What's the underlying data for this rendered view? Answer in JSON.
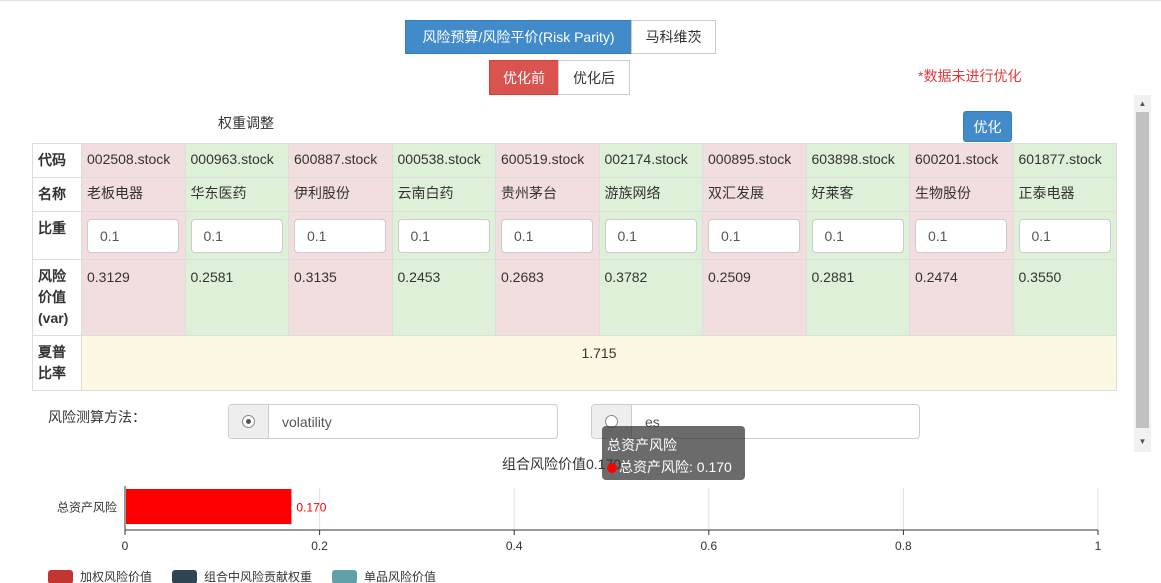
{
  "method_tabs": [
    {
      "label": "风险预算/风险平价(Risk Parity)",
      "active": true
    },
    {
      "label": "马科维茨",
      "active": false
    }
  ],
  "phase_tabs": [
    {
      "label": "优化前",
      "active": true
    },
    {
      "label": "优化后",
      "active": false
    }
  ],
  "warning": "*数据未进行优化",
  "section_title": "权重调整",
  "optimize_label": "优化",
  "table": {
    "row_headers": {
      "code": "代码",
      "name": "名称",
      "weight": "比重",
      "var": "风险价值(var)",
      "sharpe": "夏普比率"
    },
    "stocks": [
      {
        "code": "002508.stock",
        "name": "老板电器",
        "weight": "0.1",
        "var": "0.3129",
        "tone": "pink"
      },
      {
        "code": "000963.stock",
        "name": "华东医药",
        "weight": "0.1",
        "var": "0.2581",
        "tone": "green"
      },
      {
        "code": "600887.stock",
        "name": "伊利股份",
        "weight": "0.1",
        "var": "0.3135",
        "tone": "pink"
      },
      {
        "code": "000538.stock",
        "name": "云南白药",
        "weight": "0.1",
        "var": "0.2453",
        "tone": "green"
      },
      {
        "code": "600519.stock",
        "name": "贵州茅台",
        "weight": "0.1",
        "var": "0.2683",
        "tone": "pink"
      },
      {
        "code": "002174.stock",
        "name": "游族网络",
        "weight": "0.1",
        "var": "0.3782",
        "tone": "green"
      },
      {
        "code": "000895.stock",
        "name": "双汇发展",
        "weight": "0.1",
        "var": "0.2509",
        "tone": "pink"
      },
      {
        "code": "603898.stock",
        "name": "好莱客",
        "weight": "0.1",
        "var": "0.2881",
        "tone": "green"
      },
      {
        "code": "600201.stock",
        "name": "生物股份",
        "weight": "0.1",
        "var": "0.2474",
        "tone": "pink"
      },
      {
        "code": "601877.stock",
        "name": "正泰电器",
        "weight": "0.1",
        "var": "0.3550",
        "tone": "green"
      }
    ],
    "sharpe_value": "1.715"
  },
  "risk_method": {
    "label": "风险测算方法：",
    "options": [
      {
        "value": "volatility",
        "selected": true
      },
      {
        "value": "es",
        "selected": false
      }
    ]
  },
  "chart_title": "组合风险价值0.170",
  "tooltip": {
    "title": "总资产风险",
    "line": "总资产风险: 0.170",
    "dot_color": "#ff0000"
  },
  "chart_data": {
    "type": "bar",
    "orientation": "horizontal",
    "categories": [
      "总资产风险"
    ],
    "series": [
      {
        "values": [
          0.17
        ],
        "color": "#ff0000"
      }
    ],
    "data_labels": [
      "0.170"
    ],
    "xlim": [
      0,
      1
    ],
    "xticks": [
      "0",
      "0.2",
      "0.4",
      "0.6",
      "0.8",
      "1"
    ],
    "grid": true
  },
  "legend": [
    {
      "label": "加权风险价值",
      "color": "#c23531"
    },
    {
      "label": "组合中风险贡献权重",
      "color": "#2f4554"
    },
    {
      "label": "单品风险价值",
      "color": "#61a0a8"
    }
  ]
}
